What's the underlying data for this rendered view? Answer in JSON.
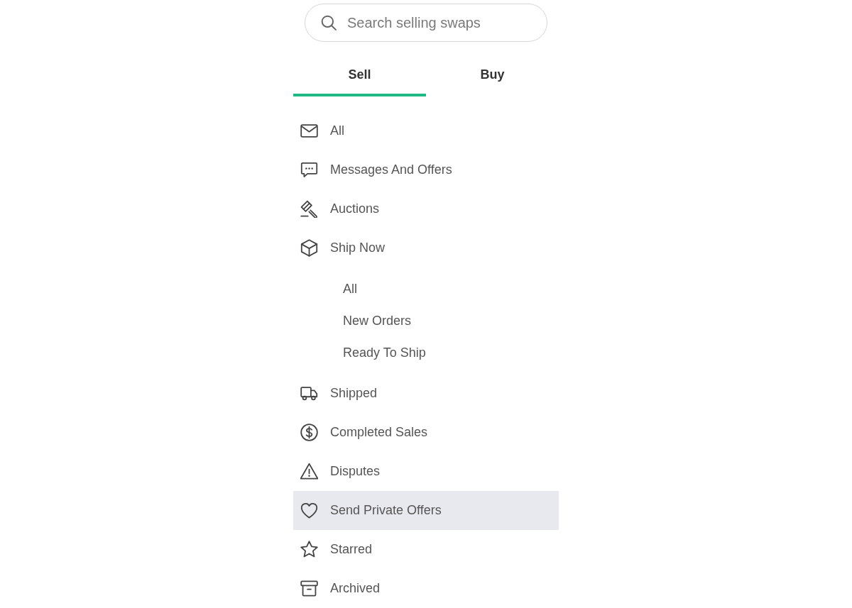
{
  "search": {
    "placeholder": "Search selling swaps"
  },
  "tabs": [
    {
      "label": "Sell",
      "selected": true
    },
    {
      "label": "Buy",
      "selected": false
    }
  ],
  "menu": [
    {
      "label": "All",
      "selected": false
    },
    {
      "label": "Messages And Offers",
      "selected": false
    },
    {
      "label": "Auctions",
      "selected": false
    },
    {
      "label": "Ship Now",
      "selected": false,
      "children": [
        {
          "label": "All",
          "selected": false
        },
        {
          "label": "New Orders",
          "selected": false
        },
        {
          "label": "Ready To Ship",
          "selected": false
        }
      ]
    },
    {
      "label": "Shipped",
      "selected": false
    },
    {
      "label": "Completed Sales",
      "selected": false
    },
    {
      "label": "Disputes",
      "selected": false
    },
    {
      "label": "Send Private Offers",
      "selected": true
    },
    {
      "label": "Starred",
      "selected": false
    },
    {
      "label": "Archived",
      "selected": false
    }
  ]
}
